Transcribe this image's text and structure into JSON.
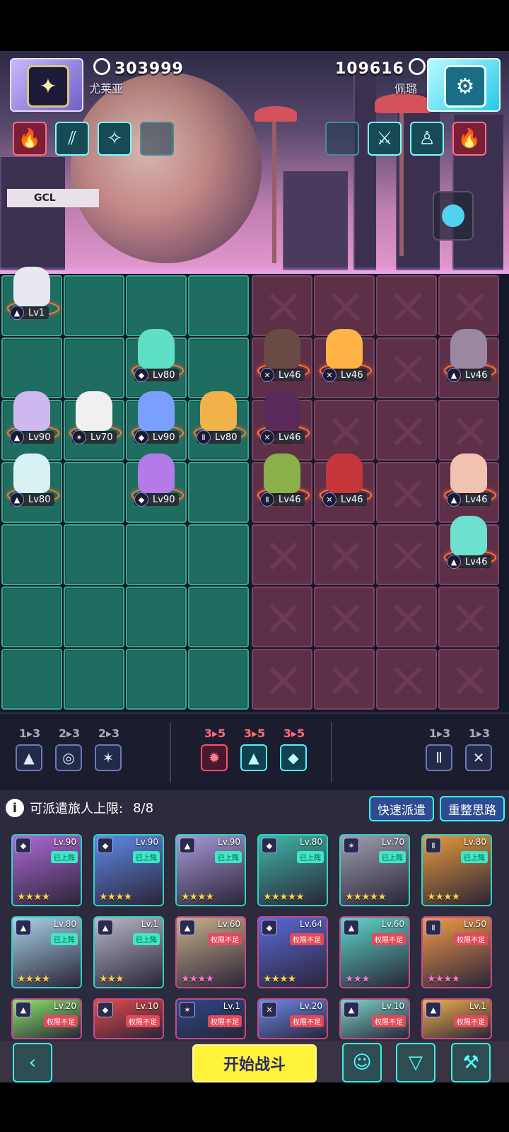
{
  "player_left": {
    "score": "303999",
    "name": "尤莱亚"
  },
  "player_right": {
    "score": "109616",
    "name": "佩璐"
  },
  "skills_left": [
    "fire-icon",
    "double-slash-icon",
    "sparkle-icon",
    "empty-slot"
  ],
  "skills_right": [
    "empty-slot",
    "sword-icon",
    "meditate-icon",
    "fire-icon"
  ],
  "scene_sign": "GCL",
  "ally_units": [
    {
      "lv": "Lv1",
      "cls": "▲",
      "color": "#e8e8f0"
    },
    {
      "lv": "Lv80",
      "cls": "◆",
      "color": "#5fe0c4"
    },
    {
      "lv": "Lv90",
      "cls": "▲",
      "color": "#cdb8f0"
    },
    {
      "lv": "Lv70",
      "cls": "✶",
      "color": "#f0f0f0"
    },
    {
      "lv": "Lv90",
      "cls": "◆",
      "color": "#7aa0ff"
    },
    {
      "lv": "Lv80",
      "cls": "Ⅱ",
      "color": "#f2b24a"
    },
    {
      "lv": "Lv80",
      "cls": "▲",
      "color": "#d8f2f4"
    },
    {
      "lv": "Lv90",
      "cls": "◆",
      "color": "#b47ae8"
    }
  ],
  "enemy_units": [
    {
      "lv": "Lv46",
      "cls": "✕",
      "color": "#6a4a44"
    },
    {
      "lv": "Lv46",
      "cls": "✕",
      "color": "#ffb445"
    },
    {
      "lv": "Lv46",
      "cls": "▲",
      "color": "#9a88a0"
    },
    {
      "lv": "Lv46",
      "cls": "✕",
      "color": "#5a2a5a"
    },
    {
      "lv": "Lv46",
      "cls": "Ⅱ",
      "color": "#8ab04a"
    },
    {
      "lv": "Lv46",
      "cls": "✕",
      "color": "#c4363a"
    },
    {
      "lv": "Lv46",
      "cls": "▲",
      "color": "#f2c2b0"
    },
    {
      "lv": "Lv46",
      "cls": "▲",
      "color": "#6ee0d0"
    }
  ],
  "synergies": [
    {
      "count": "1▸3",
      "icon": "▲",
      "style": "plain"
    },
    {
      "count": "2▸3",
      "icon": "◎",
      "style": "plain"
    },
    {
      "count": "2▸3",
      "icon": "✶",
      "style": "plain"
    },
    {
      "count": "3▸5",
      "icon": "✹",
      "style": "red"
    },
    {
      "count": "3▸5",
      "icon": "▲",
      "style": "cyan"
    },
    {
      "count": "3▸5",
      "icon": "◆",
      "style": "cyan"
    },
    {
      "count": "1▸3",
      "icon": "Ⅱ",
      "style": "plain"
    },
    {
      "count": "1▸3",
      "icon": "✕",
      "style": "plain"
    }
  ],
  "roster": {
    "label": "可派遣旅人上限:",
    "value": "8/8",
    "quick_button": "快速派遣",
    "reset_button": "重整思路",
    "cards": [
      {
        "lv": "Lv.90",
        "status": "已上阵",
        "ok": true,
        "stars": "★★★★",
        "pink": false,
        "cls": "◆",
        "color": "#b06ad8"
      },
      {
        "lv": "Lv.90",
        "status": "已上阵",
        "ok": true,
        "stars": "★★★★",
        "pink": false,
        "cls": "◆",
        "color": "#5f8ae8"
      },
      {
        "lv": "Lv.90",
        "status": "已上阵",
        "ok": true,
        "stars": "★★★★",
        "pink": false,
        "cls": "▲",
        "color": "#a89bd8"
      },
      {
        "lv": "Lv.80",
        "status": "已上阵",
        "ok": true,
        "stars": "★★★★★",
        "pink": false,
        "cls": "◆",
        "color": "#3fb7a8"
      },
      {
        "lv": "Lv.70",
        "status": "已上阵",
        "ok": true,
        "stars": "★★★★★",
        "pink": false,
        "cls": "✶",
        "color": "#9da0b0"
      },
      {
        "lv": "Lv.80",
        "status": "已上阵",
        "ok": true,
        "stars": "★★★★",
        "pink": false,
        "cls": "Ⅱ",
        "color": "#e89b3a"
      },
      {
        "lv": "Lv.80",
        "status": "已上阵",
        "ok": true,
        "stars": "★★★★",
        "pink": false,
        "cls": "▲",
        "color": "#a8d4e8"
      },
      {
        "lv": "Lv.1",
        "status": "已上阵",
        "ok": true,
        "stars": "★★★",
        "pink": false,
        "cls": "▲",
        "color": "#b8b8c8"
      },
      {
        "lv": "Lv.60",
        "status": "权限不足",
        "ok": false,
        "stars": "★★★★",
        "pink": true,
        "cls": "▲",
        "color": "#c8b08a"
      },
      {
        "lv": "Lv.64",
        "status": "权限不足",
        "ok": false,
        "stars": "★★★★",
        "pink": false,
        "cls": "◆",
        "color": "#5a6ad8"
      },
      {
        "lv": "Lv.60",
        "status": "权限不足",
        "ok": false,
        "stars": "★★★",
        "pink": true,
        "cls": "▲",
        "color": "#5ad8c8"
      },
      {
        "lv": "Lv.50",
        "status": "权限不足",
        "ok": false,
        "stars": "★★★★",
        "pink": true,
        "cls": "Ⅱ",
        "color": "#f29a4a"
      },
      {
        "lv": "Lv.20",
        "status": "权限不足",
        "ok": false,
        "stars": "",
        "pink": false,
        "cls": "▲",
        "color": "#8ae86a"
      },
      {
        "lv": "Lv.10",
        "status": "权限不足",
        "ok": false,
        "stars": "",
        "pink": false,
        "cls": "◆",
        "color": "#e84a4a"
      },
      {
        "lv": "Lv.1",
        "status": "权限不足",
        "ok": false,
        "stars": "",
        "pink": false,
        "cls": "✶",
        "color": "#2a4a8a"
      },
      {
        "lv": "Lv.20",
        "status": "权限不足",
        "ok": false,
        "stars": "",
        "pink": false,
        "cls": "✕",
        "color": "#6a8ae8"
      },
      {
        "lv": "Lv.10",
        "status": "权限不足",
        "ok": false,
        "stars": "",
        "pink": false,
        "cls": "▲",
        "color": "#7ad8c8"
      },
      {
        "lv": "Lv.1",
        "status": "权限不足",
        "ok": false,
        "stars": "",
        "pink": false,
        "cls": "▲",
        "color": "#f2b24a"
      }
    ]
  },
  "bottom": {
    "back_icon": "chevron-left-icon",
    "start_label": "开始战斗",
    "brain_icon": "brain-icon",
    "filter_icon": "filter-icon",
    "wrench_icon": "wrench-icon"
  }
}
